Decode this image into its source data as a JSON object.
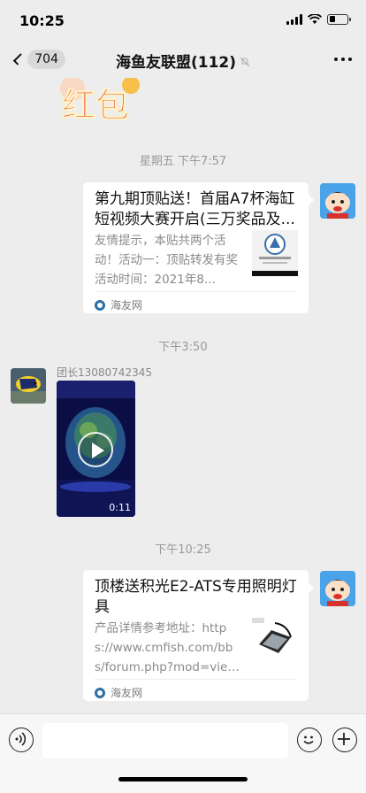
{
  "status": {
    "time": "10:25"
  },
  "nav": {
    "back_count": "704",
    "title": "海鱼友联盟(112)"
  },
  "sticker": {
    "text": "红包"
  },
  "messages": [
    {
      "timestamp": "星期五 下午7:57",
      "type": "link",
      "title": "第九期顶贴送！首届A7杯海缸短视频大赛开启(三万奖品及...",
      "description": "友情提示，本贴共两个活动！活动一：顶贴转发有奖活动时间：2021年8...",
      "source": "海友网"
    },
    {
      "timestamp": "下午3:50",
      "type": "video",
      "sender": "团长13080742345",
      "duration": "0:11"
    },
    {
      "timestamp": "下午10:25",
      "type": "link",
      "title": "顶楼送积光E2-ATS专用照明灯具",
      "description": "产品详情参考地址：https://www.cmfish.com/bbs/forum.php?mod=viewthr...",
      "source": "海友网"
    }
  ],
  "colors": {
    "background": "#ededed",
    "card": "#ffffff",
    "timestamp": "#999999"
  }
}
